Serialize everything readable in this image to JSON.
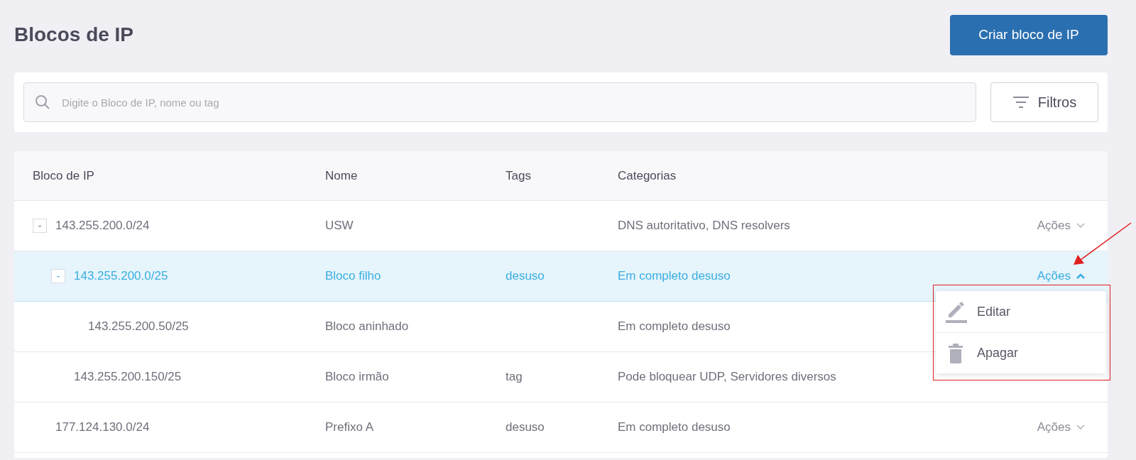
{
  "page_title": "Blocos de IP",
  "create_button": "Criar bloco de IP",
  "search": {
    "placeholder": "Digite o Bloco de IP, nome ou tag"
  },
  "filters_button": "Filtros",
  "table": {
    "columns": [
      "Bloco de IP",
      "Nome",
      "Tags",
      "Categorias"
    ],
    "rows": [
      {
        "toggle": "-",
        "expanded": true,
        "selected": false,
        "ip": "143.255.200.0/24",
        "name": "USW",
        "categories": "DNS autoritativo, DNS resolvers",
        "actions": "Ações",
        "children": [
          {
            "toggle": "-",
            "expanded": true,
            "selected": true,
            "menu_open": true,
            "ip": "143.255.200.0/25",
            "name": "Bloco filho",
            "tags": "desuso",
            "categories": "Em completo desuso",
            "actions": "Ações",
            "children": [
              {
                "selected": false,
                "ip": "143.255.200.50/25",
                "name": "Bloco aninhado",
                "categories": "Em completo desuso"
              }
            ]
          },
          {
            "selected": false,
            "ip": "143.255.200.150/25",
            "name": "Bloco irmão",
            "tags": "tag",
            "categories": "Pode bloquear UDP, Servidores diversos"
          }
        ]
      },
      {
        "selected": false,
        "ip": "177.124.130.0/24",
        "name": "Prefixo A",
        "tags": "desuso",
        "categories": "Em completo desuso",
        "actions": "Ações"
      }
    ]
  },
  "actions_menu": [
    {
      "kind": "edit",
      "label": "Editar"
    },
    {
      "kind": "delete",
      "label": "Apagar"
    }
  ]
}
